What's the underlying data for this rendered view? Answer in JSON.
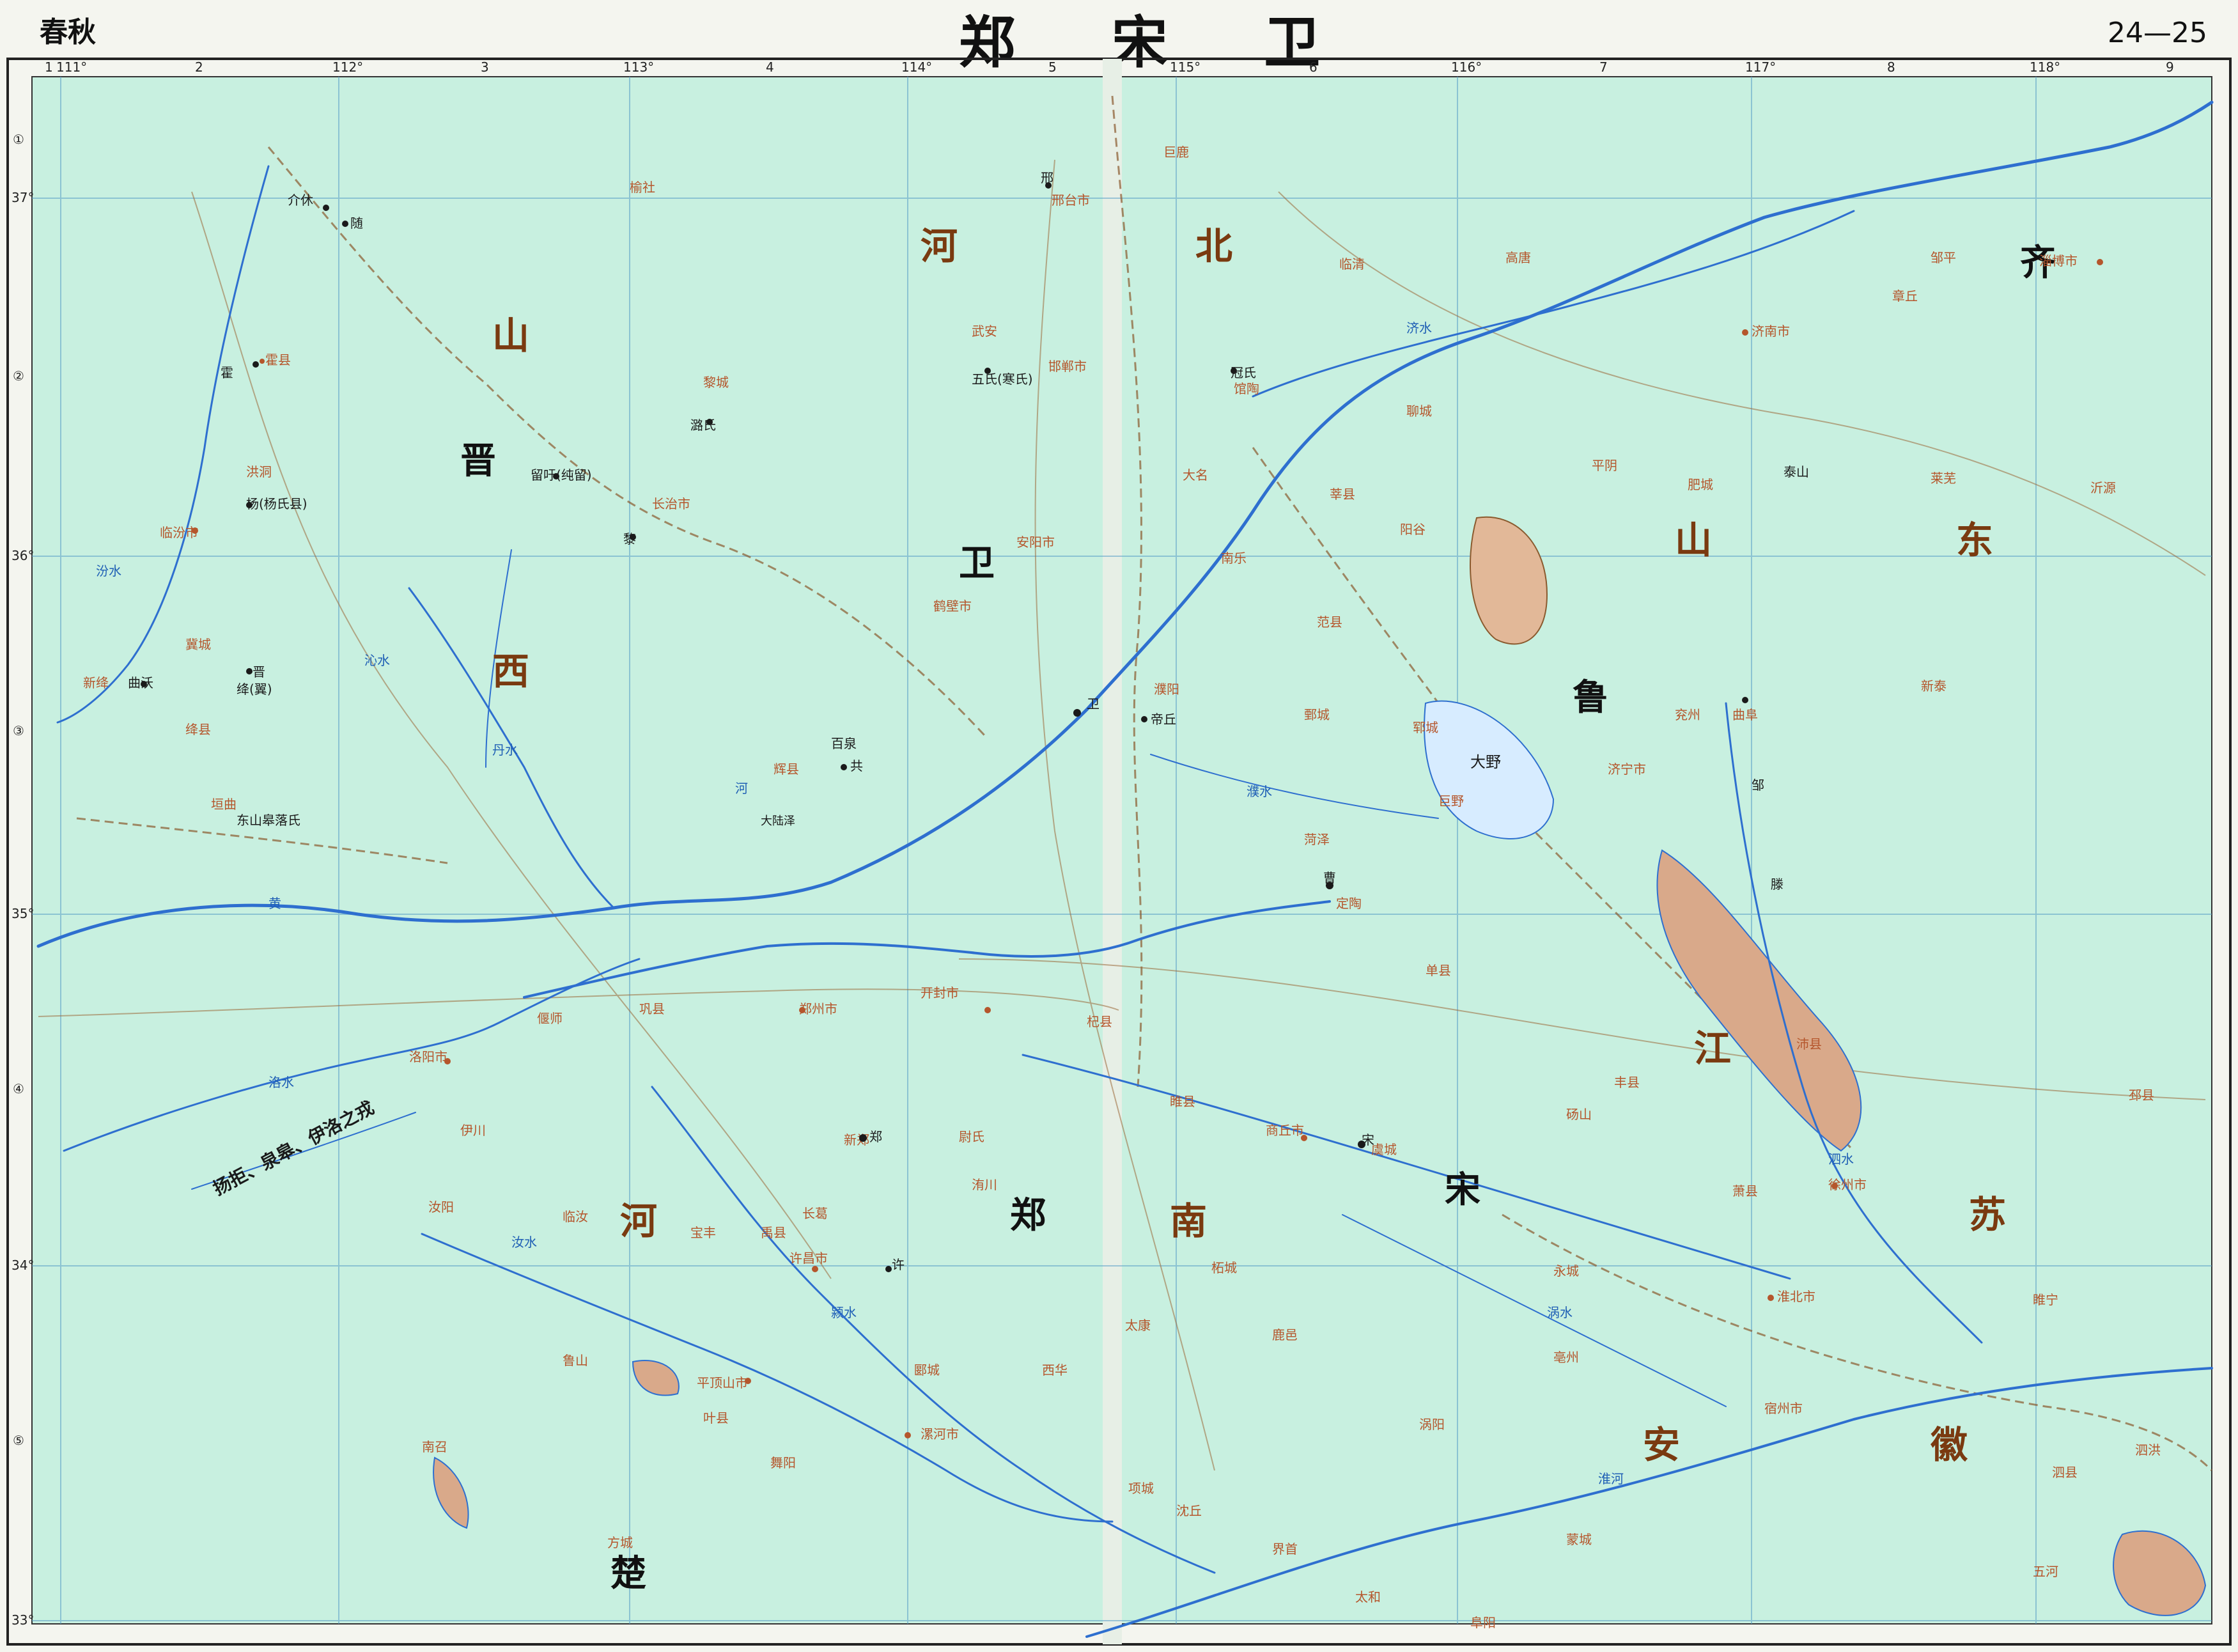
{
  "header": {
    "period": "春秋",
    "title": "郑 宋 卫",
    "pages": "24—25"
  },
  "colors": {
    "land": "#c8f0e0",
    "water_river": "#2e6fcf",
    "lake": "#d7ecff",
    "province_border": "#8a5a2e",
    "marsh": "#d9a98a",
    "modern_city": "#b5562c"
  },
  "grid": {
    "columns": [
      "1",
      "2",
      "3",
      "4",
      "5",
      "6",
      "7",
      "8",
      "9"
    ],
    "rows": [
      "①",
      "②",
      "③",
      "④",
      "⑤"
    ],
    "longitudes": [
      "111°",
      "112°",
      "113°",
      "114°",
      "115°",
      "116°",
      "117°",
      "118°"
    ],
    "latitudes": [
      "37°",
      "36°",
      "35°",
      "34°",
      "33°"
    ]
  },
  "states": [
    "晋",
    "卫",
    "郑",
    "宋",
    "鲁",
    "齐",
    "楚"
  ],
  "modern_regions": [
    "山",
    "西",
    "河",
    "北",
    "山",
    "东",
    "河",
    "南",
    "江",
    "苏",
    "安",
    "徽"
  ],
  "rivers": [
    "黄",
    "河",
    "沁水",
    "汾水",
    "济水",
    "洛水",
    "颍水",
    "汝水",
    "泗水",
    "淮河",
    "涡水",
    "濮水",
    "丹水"
  ],
  "cities": {
    "north_west": [
      "介休",
      "随",
      "霍",
      "霍县",
      "洪洞",
      "杨(杨氏县)",
      "临汾市",
      "冀城",
      "晋",
      "绛(翼)",
      "曲沃",
      "新绛",
      "绛县",
      "垣曲",
      "东山皋落氏"
    ],
    "north_central": [
      "榆社",
      "邢",
      "邢台市",
      "武安",
      "邯郸市",
      "五氏(寒氏)",
      "黎城",
      "潞氏",
      "留吁(纯留)",
      "长治市",
      "黎",
      "安阳市",
      "鹤壁市",
      "辉县",
      "共",
      "百泉"
    ],
    "north_east": [
      "巨鹿",
      "临清",
      "高唐",
      "聊城",
      "冠氏",
      "馆陶",
      "大名",
      "南乐",
      "范县",
      "阳谷",
      "莘县",
      "鄄城",
      "郓城",
      "菏泽",
      "巨野",
      "济宁市",
      "曲阜",
      "邹",
      "滕",
      "兖州",
      "新泰",
      "济南市",
      "淄博市",
      "章丘",
      "邹平",
      "莱芜",
      "沂源",
      "平阴",
      "肥城",
      "泰山"
    ],
    "central": [
      "卫",
      "濮阳",
      "帝丘",
      "曹",
      "定陶",
      "商丘市",
      "宋",
      "虞城",
      "亳州",
      "柘城",
      "鹿邑",
      "太康",
      "睢县",
      "杞县",
      "开封市",
      "郑州市",
      "新郑",
      "郑",
      "许昌市",
      "许",
      "禹县",
      "长葛",
      "尉氏",
      "洧川"
    ],
    "south_west": [
      "洛阳市",
      "偃师",
      "巩县",
      "伊川",
      "汝阳",
      "临汝",
      "宝丰",
      "鲁山",
      "叶县",
      "平顶山市",
      "方城",
      "南召",
      "舞阳",
      "漯河市",
      "郾城",
      "西华",
      "项城",
      "沈丘"
    ],
    "south_east": [
      "淮北市",
      "宿州市",
      "徐州市",
      "萧县",
      "砀山",
      "单县",
      "丰县",
      "沛县",
      "邳县",
      "睢宁",
      "泗县",
      "泗洪",
      "五河",
      "蒙城",
      "涡阳",
      "永城",
      "太和",
      "界首",
      "阜阳"
    ]
  },
  "annotations": [
    "扬拒、泉皋、伊洛之戎",
    "大陆泽",
    "大野"
  ]
}
